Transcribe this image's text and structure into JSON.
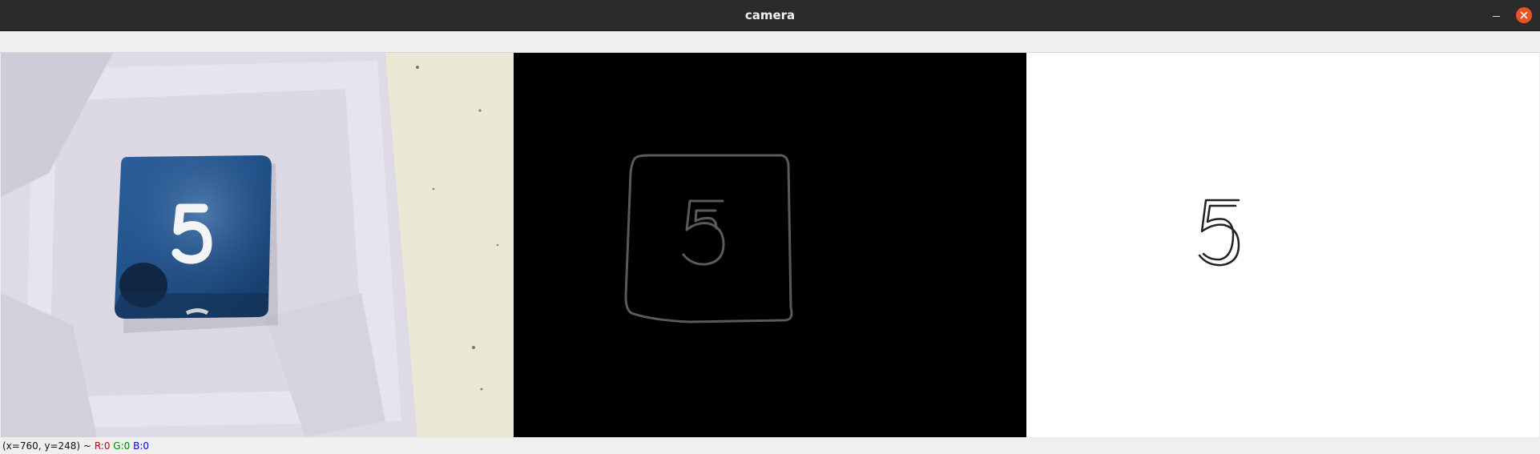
{
  "window": {
    "title": "camera"
  },
  "panels": [
    {
      "name": "original-camera-image",
      "content": "white dice showing face 5 in paper box"
    },
    {
      "name": "edge-detection-image",
      "background": "#000000",
      "stroke": "#5a5a5a"
    },
    {
      "name": "digit-contour-image",
      "background": "#ffffff",
      "stroke": "#222222"
    }
  ],
  "statusbar": {
    "coords": "(x=760, y=248) ~",
    "r_label": "R:0",
    "g_label": "G:0",
    "b_label": "B:0"
  },
  "colors": {
    "titlebar": "#2b2b2b",
    "close_button": "#e95420",
    "die_blue": "#1f4f86",
    "red": "#d00000",
    "green": "#008800",
    "blue": "#0000d0"
  },
  "icons": {
    "minimize": "minimize-icon",
    "close": "close-icon"
  }
}
